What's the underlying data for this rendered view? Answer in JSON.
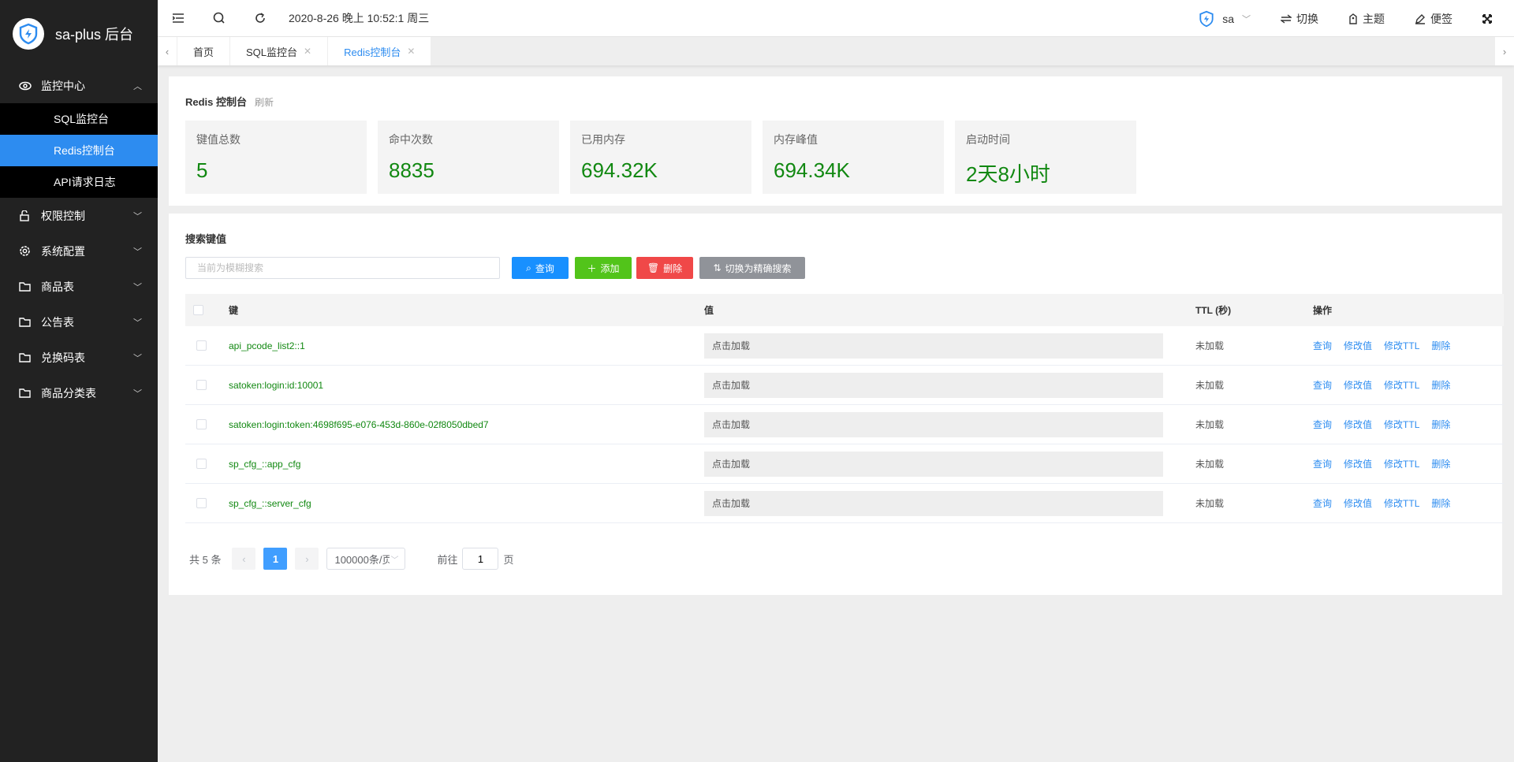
{
  "app": {
    "title": "sa-plus 后台"
  },
  "sidebar": {
    "groups": [
      {
        "label": "监控中心",
        "icon": "eye-icon",
        "expanded": true,
        "children": [
          "SQL监控台",
          "Redis控制台",
          "API请求日志"
        ]
      },
      {
        "label": "权限控制",
        "icon": "lock-icon"
      },
      {
        "label": "系统配置",
        "icon": "gear-icon"
      },
      {
        "label": "商品表",
        "icon": "folder-icon"
      },
      {
        "label": "公告表",
        "icon": "folder-icon"
      },
      {
        "label": "兑换码表",
        "icon": "folder-icon"
      },
      {
        "label": "商品分类表",
        "icon": "folder-icon"
      }
    ],
    "active": "Redis控制台"
  },
  "topbar": {
    "datetime": "2020-8-26 晚上 10:52:1 周三",
    "user": "sa",
    "switch": "切换",
    "theme": "主题",
    "notes": "便签"
  },
  "tabs": [
    {
      "label": "首页"
    },
    {
      "label": "SQL监控台",
      "closable": true
    },
    {
      "label": "Redis控制台",
      "closable": true,
      "active": true
    }
  ],
  "overview": {
    "title": "Redis 控制台",
    "refresh": "刷新",
    "stats": [
      {
        "label": "键值总数",
        "value": "5"
      },
      {
        "label": "命中次数",
        "value": "8835"
      },
      {
        "label": "已用内存",
        "value": "694.32K"
      },
      {
        "label": "内存峰值",
        "value": "694.34K"
      },
      {
        "label": "启动时间",
        "value": "2天8小时"
      }
    ]
  },
  "search": {
    "title": "搜索键值",
    "placeholder": "当前为模糊搜索",
    "query": "查询",
    "add": "添加",
    "delete": "删除",
    "toggle": "切换为精确搜索"
  },
  "table": {
    "headers": {
      "key": "键",
      "value": "值",
      "ttl": "TTL (秒)",
      "ops": "操作"
    },
    "rows": [
      {
        "key": "api_pcode_list2::1",
        "value": "点击加载",
        "ttl": "未加载"
      },
      {
        "key": "satoken:login:id:10001",
        "value": "点击加载",
        "ttl": "未加载"
      },
      {
        "key": "satoken:login:token:4698f695-e076-453d-860e-02f8050dbed7",
        "value": "点击加载",
        "ttl": "未加载"
      },
      {
        "key": "sp_cfg_::app_cfg",
        "value": "点击加载",
        "ttl": "未加载"
      },
      {
        "key": "sp_cfg_::server_cfg",
        "value": "点击加载",
        "ttl": "未加载"
      }
    ],
    "ops": [
      "查询",
      "修改值",
      "修改TTL",
      "删除"
    ]
  },
  "pagination": {
    "total": "共 5 条",
    "current": "1",
    "page_size": "100000条/页",
    "goto_prefix": "前往",
    "goto_value": "1",
    "goto_suffix": "页"
  },
  "colors": {
    "accent": "#2d8cf0",
    "green": "#118811",
    "sidebar": "#222222"
  }
}
